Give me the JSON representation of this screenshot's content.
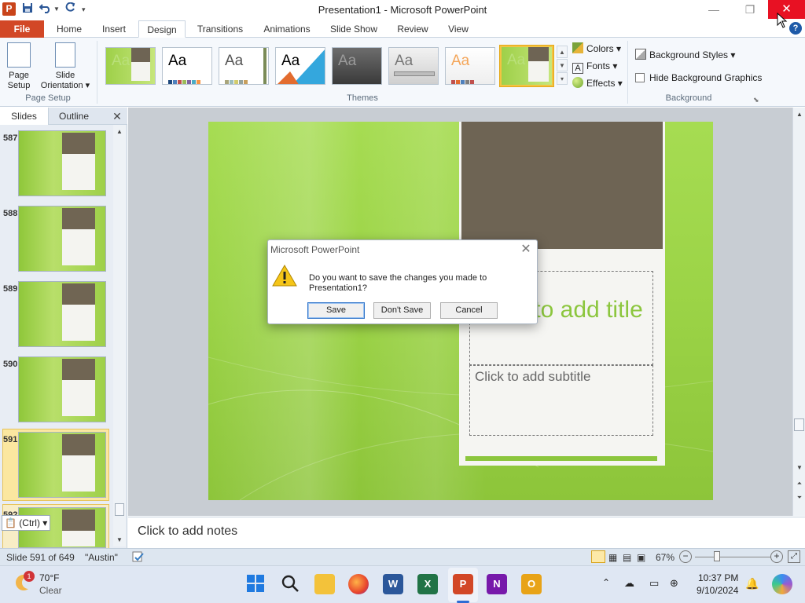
{
  "window": {
    "title": "Presentation1 - Microsoft PowerPoint",
    "app_icon_letter": "P",
    "close_glyph": "✕",
    "help_glyph": "?"
  },
  "ribbon_tabs": {
    "file": "File",
    "home": "Home",
    "insert": "Insert",
    "design": "Design",
    "transitions": "Transitions",
    "animations": "Animations",
    "slide_show": "Slide Show",
    "review": "Review",
    "view": "View",
    "active": "Design"
  },
  "ribbon": {
    "page_setup": {
      "label_line1": "Page",
      "label_line2": "Setup"
    },
    "slide_orientation": {
      "label_line1": "Slide",
      "label_line2": "Orientation ▾"
    },
    "group_page_setup": "Page Setup",
    "group_themes": "Themes",
    "group_background": "Background",
    "theme_sample": "Aa",
    "colors": "Colors ▾",
    "fonts": "Fonts ▾",
    "effects": "Effects ▾",
    "background_styles": "Background Styles ▾",
    "hide_background_graphics": "Hide Background Graphics"
  },
  "slides_pane": {
    "tab_slides": "Slides",
    "tab_outline": "Outline",
    "close_glyph": "✕",
    "slide_numbers": [
      "587",
      "588",
      "589",
      "590",
      "591",
      "592"
    ],
    "selected_slide": "591",
    "paste_options": "(Ctrl) ▾"
  },
  "slide": {
    "title_placeholder": "Click to add title",
    "subtitle_placeholder": "Click to add subtitle"
  },
  "notes": {
    "placeholder": "Click to add notes"
  },
  "status_bar": {
    "slide_position": "Slide 591 of 649",
    "theme_name": "\"Austin\"",
    "zoom": "67%"
  },
  "dialog": {
    "title": "Microsoft PowerPoint",
    "message_line1": "Do you want to save the changes you made to",
    "message_line2": "Presentation1?",
    "save": "Save",
    "dont_save": "Don't Save",
    "cancel": "Cancel",
    "close_glyph": "✕"
  },
  "taskbar": {
    "weather_temp": "70°F",
    "weather_desc": "Clear",
    "weather_badge": "1",
    "time": "10:37 PM",
    "date": "9/10/2024"
  },
  "colors": {
    "file_tab": "#d24726",
    "slide_green": "#9cd447",
    "slide_dark": "#6e6454",
    "title_green": "#8cc63e",
    "close_red": "#e81123",
    "selection_gold": "#f3c342"
  }
}
